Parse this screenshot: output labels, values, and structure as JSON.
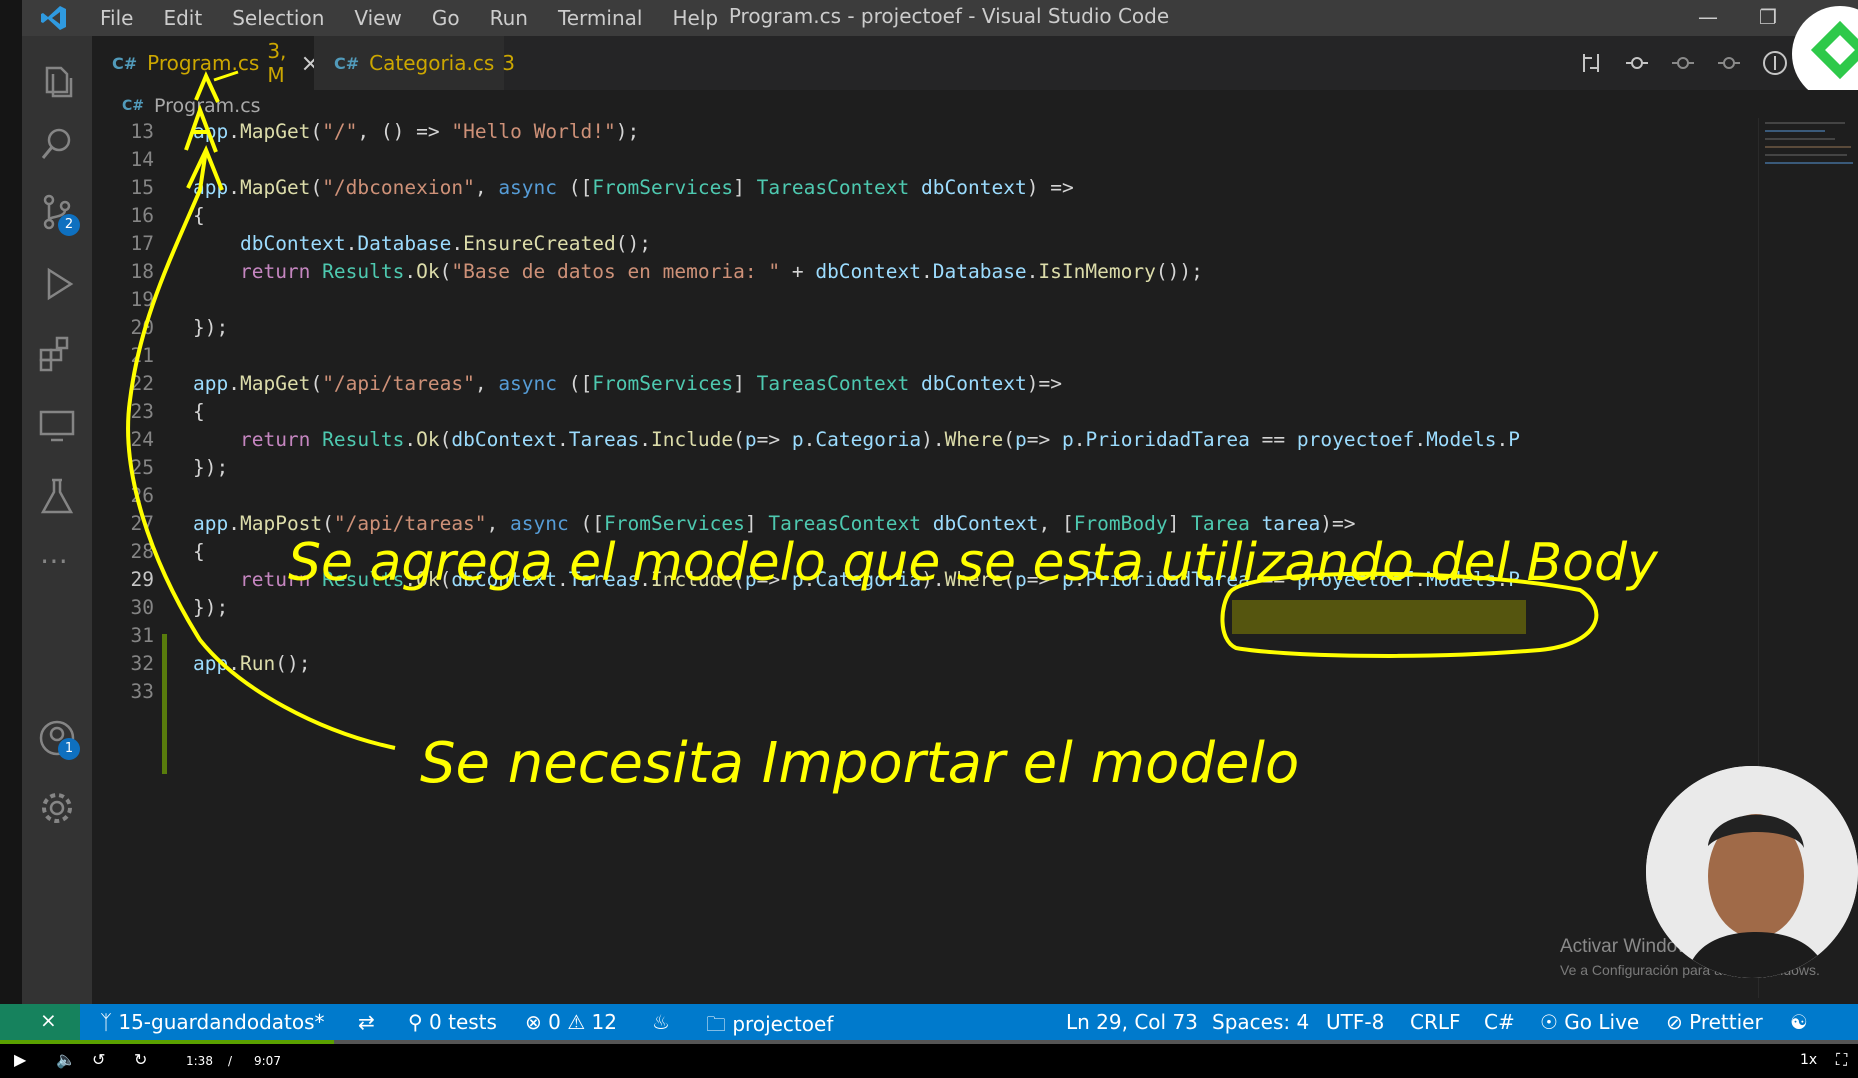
{
  "titlebar": {
    "menu": [
      "File",
      "Edit",
      "Selection",
      "View",
      "Go",
      "Run",
      "Terminal",
      "Help"
    ],
    "window_title": "Program.cs - projectoef - Visual Studio Code"
  },
  "activity": {
    "source_control_badge": "2",
    "accounts_badge": "1"
  },
  "tabs": [
    {
      "label": "Program.cs",
      "status": "3, M",
      "active": true
    },
    {
      "label": "Categoria.cs",
      "status": "3",
      "active": false
    }
  ],
  "breadcrumb": "Program.cs",
  "code_lines": [
    {
      "n": "13",
      "code": "app.MapGet(\"/\", () => \"Hello World!\");"
    },
    {
      "n": "14",
      "code": ""
    },
    {
      "n": "15",
      "code": "app.MapGet(\"/dbconexion\", async ([FromServices] TareasContext dbContext) =>"
    },
    {
      "n": "16",
      "code": "{"
    },
    {
      "n": "17",
      "code": "    dbContext.Database.EnsureCreated();"
    },
    {
      "n": "18",
      "code": "    return Results.Ok(\"Base de datos en memoria: \" + dbContext.Database.IsInMemory());"
    },
    {
      "n": "19",
      "code": ""
    },
    {
      "n": "20",
      "code": "});"
    },
    {
      "n": "21",
      "code": ""
    },
    {
      "n": "22",
      "code": "app.MapGet(\"/api/tareas\", async ([FromServices] TareasContext dbContext)=>"
    },
    {
      "n": "23",
      "code": "{"
    },
    {
      "n": "24",
      "code": "    return Results.Ok(dbContext.Tareas.Include(p=> p.Categoria).Where(p=> p.PrioridadTarea == proyectoef.Models.P"
    },
    {
      "n": "25",
      "code": "});"
    },
    {
      "n": "26",
      "code": ""
    },
    {
      "n": "27",
      "code": "app.MapPost(\"/api/tareas\", async ([FromServices] TareasContext dbContext, [FromBody] Tarea tarea)=>"
    },
    {
      "n": "28",
      "code": "{"
    },
    {
      "n": "29",
      "code": "    return Results.Ok(dbContext.Tareas.Include(p=> p.Categoria).Where(p=> p.PrioridadTarea == proyectoef.Models.P"
    },
    {
      "n": "30",
      "code": "});"
    },
    {
      "n": "31",
      "code": ""
    },
    {
      "n": "32",
      "code": "app.Run();"
    },
    {
      "n": "33",
      "code": ""
    }
  ],
  "annotations": {
    "line1": "Se agrega el modelo que se esta utilizando del Body",
    "line2": "Se necesita Importar el modelo"
  },
  "watermark": {
    "title": "Activar Windows",
    "subtitle": "Ve a Configuración para activar Windows."
  },
  "statusbar": {
    "branch": "15-guardandodatos*",
    "tests": "0 tests",
    "errors": "0",
    "warnings": "12",
    "folder": "projectoef",
    "position": "Ln 29, Col 73",
    "spaces": "Spaces: 4",
    "encoding": "UTF-8",
    "eol": "CRLF",
    "language": "C#",
    "golive": "Go Live",
    "prettier": "Prettier"
  },
  "player": {
    "current": "1:38",
    "separator": "/",
    "total": "9:07",
    "speed": "1x",
    "progress": 0.18
  },
  "colors": {
    "statusbar": "#007acc",
    "annotation": "#ffff00",
    "highlight": "#8c8c00"
  }
}
